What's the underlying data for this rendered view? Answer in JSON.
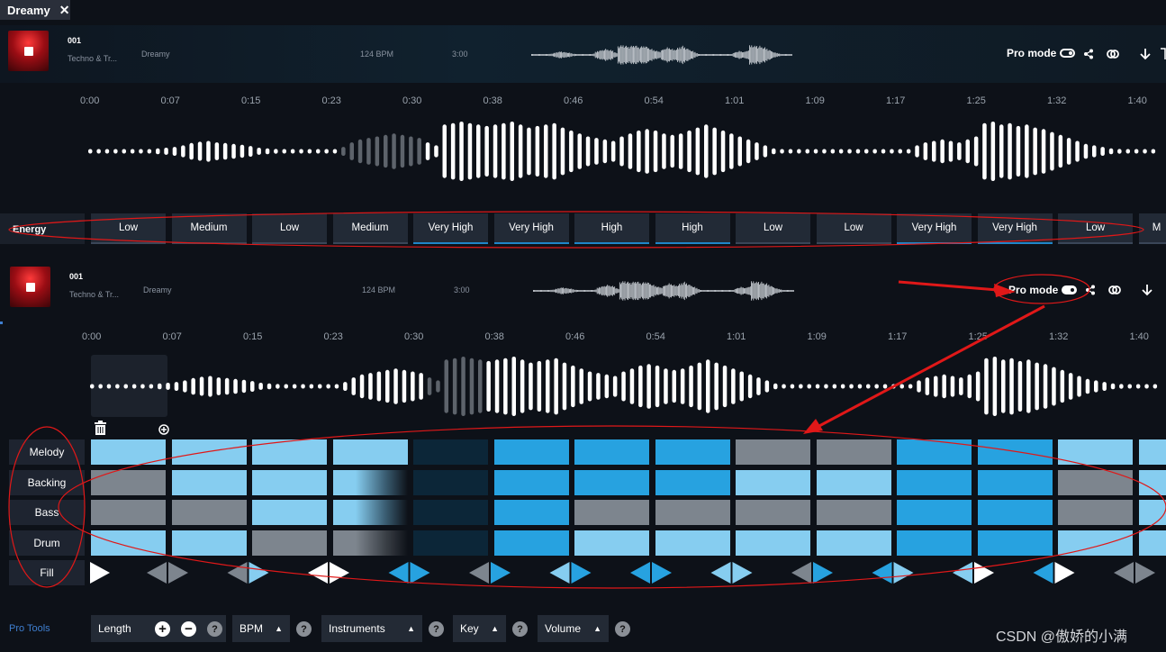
{
  "tab": {
    "label": "Dreamy",
    "close": "✕"
  },
  "tracks": [
    {
      "number": "001",
      "genre": "Techno & Tr...",
      "mood": "Dreamy",
      "bpm": "124 BPM",
      "duration": "3:00",
      "pro_mode_label": "Pro mode",
      "pro_mode_on": false
    },
    {
      "number": "001",
      "genre": "Techno & Tr...",
      "mood": "Dreamy",
      "bpm": "124 BPM",
      "duration": "3:00",
      "pro_mode_label": "Pro mode",
      "pro_mode_on": true
    }
  ],
  "timeline": [
    "0:00",
    "0:07",
    "0:15",
    "0:23",
    "0:30",
    "0:38",
    "0:46",
    "0:54",
    "1:01",
    "1:09",
    "1:17",
    "1:25",
    "1:32",
    "1:40"
  ],
  "energy": {
    "label": "Energy",
    "levels": [
      "Low",
      "Medium",
      "Low",
      "Medium",
      "Very High",
      "Very High",
      "High",
      "High",
      "Low",
      "Low",
      "Very High",
      "Very High",
      "Low",
      "M"
    ]
  },
  "waveform_levels": [
    0.05,
    0.05,
    0.05,
    0.05,
    0.05,
    0.05,
    0.05,
    0.05,
    0.1,
    0.12,
    0.15,
    0.2,
    0.28,
    0.32,
    0.35,
    0.3,
    0.28,
    0.25,
    0.22,
    0.18,
    0.12,
    0.1,
    0.08,
    0.06,
    0.05,
    0.05,
    0.05,
    0.05,
    0.05,
    0.05,
    0.15,
    0.3,
    0.4,
    0.45,
    0.5,
    0.55,
    0.6,
    0.55,
    0.5,
    0.45,
    0.3,
    0.2,
    0.9,
    0.95,
    1.0,
    0.95,
    0.9,
    0.85,
    0.9,
    0.95,
    1.0,
    0.9,
    0.8,
    0.85,
    0.9,
    0.95,
    0.8,
    0.7,
    0.6,
    0.5,
    0.45,
    0.4,
    0.35,
    0.5,
    0.6,
    0.7,
    0.75,
    0.7,
    0.6,
    0.55,
    0.6,
    0.7,
    0.8,
    0.9,
    0.8,
    0.7,
    0.6,
    0.5,
    0.4,
    0.3,
    0.2,
    0.1,
    0.05,
    0.05,
    0.05,
    0.05,
    0.05,
    0.05,
    0.05,
    0.05,
    0.05,
    0.05,
    0.05,
    0.05,
    0.05,
    0.05,
    0.05,
    0.05,
    0.2,
    0.3,
    0.35,
    0.4,
    0.35,
    0.3,
    0.4,
    0.5,
    0.95,
    1.0,
    0.9,
    0.95,
    0.85,
    0.9,
    0.8,
    0.75,
    0.65,
    0.55,
    0.45,
    0.35,
    0.25,
    0.2,
    0.15,
    0.1,
    0.08,
    0.05,
    0.05,
    0.05,
    0.05
  ],
  "grid": {
    "rows": [
      {
        "label": "Melody",
        "cells": [
          "lb",
          "lb",
          "lb",
          "lb",
          "db",
          "bl",
          "bl",
          "bl",
          "gr",
          "gr",
          "bl",
          "bl",
          "lb",
          "lb"
        ]
      },
      {
        "label": "Backing",
        "cells": [
          "gr",
          "lb",
          "lb",
          "fade",
          "db",
          "bl",
          "bl",
          "bl",
          "lb",
          "lb",
          "bl",
          "bl",
          "gr",
          "lb"
        ]
      },
      {
        "label": "Bass",
        "cells": [
          "gr",
          "gr",
          "lb",
          "fade",
          "db",
          "bl",
          "gr",
          "gr",
          "gr",
          "gr",
          "bl",
          "bl",
          "gr",
          "lb"
        ]
      },
      {
        "label": "Drum",
        "cells": [
          "lb",
          "lb",
          "gr",
          "fadeg",
          "db",
          "bl",
          "lb",
          "lb",
          "lb",
          "lb",
          "bl",
          "bl",
          "lb",
          "lb"
        ]
      }
    ],
    "fill_label": "Fill",
    "fill": [
      {
        "l": null,
        "r": "#ffffff"
      },
      {
        "l": "#7d858e",
        "r": "#7d858e"
      },
      {
        "l": "#7d858e",
        "r": "#86cdf0"
      },
      {
        "l": "#ffffff",
        "r": "#ffffff"
      },
      {
        "l": "#27a2e0",
        "r": "#27a2e0"
      },
      {
        "l": "#7d858e",
        "r": "#27a2e0"
      },
      {
        "l": "#86cdf0",
        "r": "#27a2e0"
      },
      {
        "l": "#27a2e0",
        "r": "#27a2e0"
      },
      {
        "l": "#86cdf0",
        "r": "#86cdf0"
      },
      {
        "l": "#7d858e",
        "r": "#27a2e0"
      },
      {
        "l": "#27a2e0",
        "r": "#86cdf0"
      },
      {
        "l": "#86cdf0",
        "r": "#ffffff"
      },
      {
        "l": "#27a2e0",
        "r": "#ffffff"
      },
      {
        "l": "#7d858e",
        "r": "#7d858e"
      }
    ]
  },
  "pro_tools": {
    "label": "Pro Tools",
    "length": "Length",
    "bpm": "BPM",
    "instruments": "Instruments",
    "key": "Key",
    "volume": "Volume",
    "help": "?"
  },
  "icons": {
    "trash": "trash-icon",
    "add": "add-section-icon",
    "share": "share-icon",
    "link": "link-icon",
    "download": "download-icon"
  },
  "watermark": "CSDN @傲娇的小满",
  "colors": {
    "light_blue": "#86cdf0",
    "gray": "#7d858e",
    "dark_blue": "#0c2638",
    "blue": "#27a2e0",
    "annotation_red": "#e01818"
  }
}
